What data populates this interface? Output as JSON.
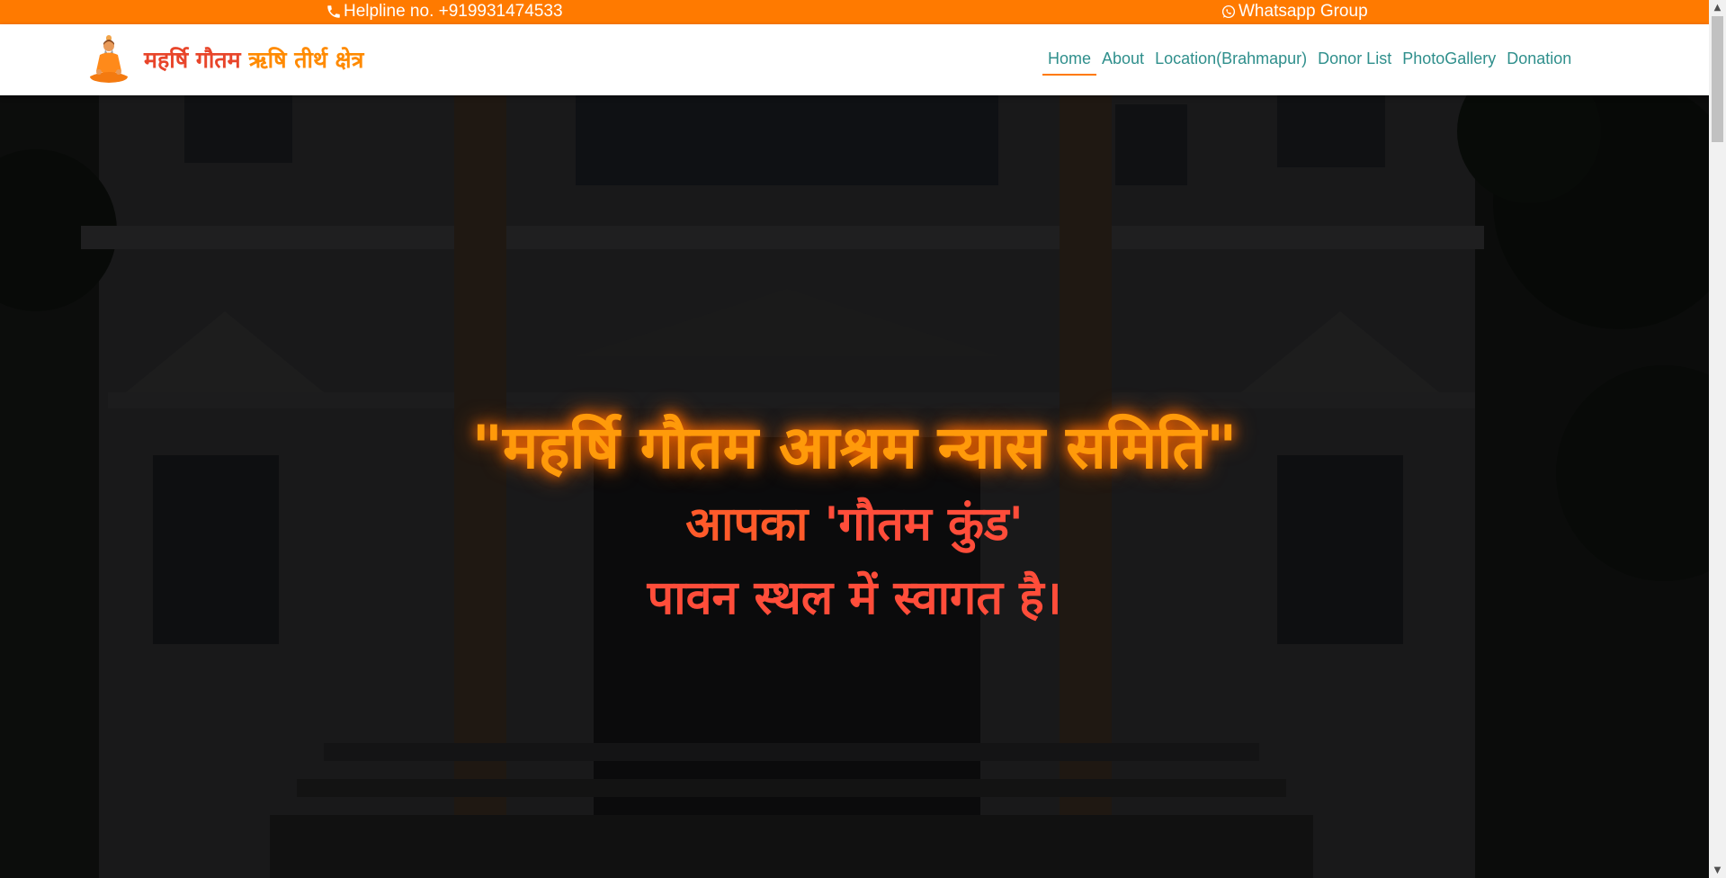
{
  "topbar": {
    "helpline": "Helpline no. +919931474533",
    "whatsapp": "Whatsapp Group",
    "phone_icon": "phone-icon",
    "whatsapp_icon": "whatsapp-icon",
    "bg_color": "#ff7a00"
  },
  "navbar": {
    "brand_part1": "महर्षि गौतम",
    "brand_part2": "ऋषि तीर्थ क्षेत्र",
    "logo_icon": "meditating-sage-logo",
    "links": [
      {
        "label": "Home",
        "active": true
      },
      {
        "label": "About"
      },
      {
        "label": "Location(Brahmapur)"
      },
      {
        "label": "Donor List"
      },
      {
        "label": "PhotoGallery"
      },
      {
        "label": "Donation"
      }
    ]
  },
  "hero": {
    "title": "\"महर्षि गौतम आश्रम न्यास समिति\"",
    "line2_prefix": "आपका ",
    "line2_highlight": "'गौतम कुंड'",
    "line3": "पावन स्थल में स्वागत है।"
  },
  "colors": {
    "accent": "#ff7a00",
    "nav_link": "#2f8f8c",
    "title_orange": "#ff9a0a",
    "subtitle_red": "#ff4d3a"
  }
}
